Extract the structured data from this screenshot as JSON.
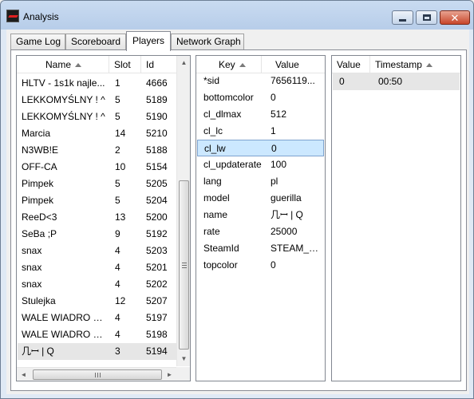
{
  "window": {
    "title": "Analysis",
    "minimize_icon": "minimize-icon",
    "maximize_icon": "maximize-icon",
    "close_icon": "close-icon",
    "close_glyph": "✕"
  },
  "tabs": [
    {
      "label": "Game Log"
    },
    {
      "label": "Scoreboard"
    },
    {
      "label": "Players"
    },
    {
      "label": "Network Graph"
    }
  ],
  "active_tab": "Players",
  "players": {
    "columns": {
      "name": "Name",
      "slot": "Slot",
      "id": "Id"
    },
    "rows": [
      {
        "name": "HLTV - 1s1k najle...",
        "slot": "1",
        "id": "4666"
      },
      {
        "name": "LEKKOMYŚLNY ! ^",
        "slot": "5",
        "id": "5189"
      },
      {
        "name": "LEKKOMYŚLNY ! ^",
        "slot": "5",
        "id": "5190"
      },
      {
        "name": "Marcia",
        "slot": "14",
        "id": "5210"
      },
      {
        "name": "N3WB!E",
        "slot": "2",
        "id": "5188"
      },
      {
        "name": "OFF-CA",
        "slot": "10",
        "id": "5154"
      },
      {
        "name": "Pimpek",
        "slot": "5",
        "id": "5205"
      },
      {
        "name": "Pimpek",
        "slot": "5",
        "id": "5204"
      },
      {
        "name": "ReeD<3",
        "slot": "13",
        "id": "5200"
      },
      {
        "name": "SeBa ;P",
        "slot": "9",
        "id": "5192"
      },
      {
        "name": "snax",
        "slot": "4",
        "id": "5203"
      },
      {
        "name": "snax",
        "slot": "4",
        "id": "5201"
      },
      {
        "name": "snax",
        "slot": "4",
        "id": "5202"
      },
      {
        "name": "Stulejka",
        "slot": "12",
        "id": "5207"
      },
      {
        "name": "WALE WIADRO W...",
        "slot": "4",
        "id": "5197"
      },
      {
        "name": "WALE WIADRO W...",
        "slot": "4",
        "id": "5198"
      },
      {
        "name": "几ꟷ | Q",
        "slot": "3",
        "id": "5194"
      }
    ],
    "selected_index": 16
  },
  "properties": {
    "columns": {
      "key": "Key",
      "value": "Value"
    },
    "rows": [
      {
        "key": "*sid",
        "value": "7656119..."
      },
      {
        "key": "bottomcolor",
        "value": "0"
      },
      {
        "key": "cl_dlmax",
        "value": "512"
      },
      {
        "key": "cl_lc",
        "value": "1"
      },
      {
        "key": "cl_lw",
        "value": "0"
      },
      {
        "key": "cl_updaterate",
        "value": "100"
      },
      {
        "key": "lang",
        "value": "pl"
      },
      {
        "key": "model",
        "value": "guerilla"
      },
      {
        "key": "name",
        "value": "几ꟷ | Q"
      },
      {
        "key": "rate",
        "value": "25000"
      },
      {
        "key": "SteamId",
        "value": "STEAM_0..."
      },
      {
        "key": "topcolor",
        "value": "0"
      }
    ],
    "selected_index": 4
  },
  "history": {
    "columns": {
      "value": "Value",
      "timestamp": "Timestamp"
    },
    "rows": [
      {
        "value": "0",
        "timestamp": "00:50"
      }
    ]
  },
  "scroll": {
    "up_glyph": "▲",
    "down_glyph": "▼",
    "left_glyph": "◄",
    "right_glyph": "►"
  },
  "colors": {
    "selection_highlight": "#cce8ff",
    "selection_inactive": "#e6e6e6",
    "close_button": "#c8462a"
  }
}
